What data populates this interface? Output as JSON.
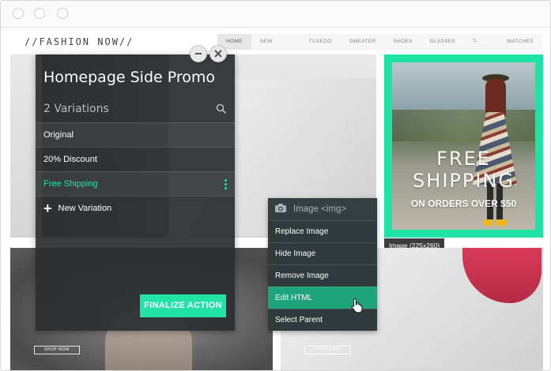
{
  "header": {
    "logo": "//FASHION NOW//",
    "nav": [
      "HOME",
      "NEW ARRIVALS",
      "TUXEDO",
      "SWEATER",
      "SHOES",
      "GLASSES",
      "T-SHIRT",
      "WATCHES"
    ]
  },
  "promo": {
    "title_line1": "FREE",
    "title_line2": "SHIPPING",
    "subtitle": "ON ORDERS OVER $50",
    "image_tag": "Image (225x260)"
  },
  "tiles": {
    "shop_now": "SHOP NOW"
  },
  "panel": {
    "title": "Homepage Side Promo",
    "count": "2 Variations",
    "variations": [
      "Original",
      "20% Discount",
      "Free Shipping"
    ],
    "new_variation": "New Variation",
    "finalize": "FINALIZE ACTION"
  },
  "context_menu": {
    "title": "Image <img>",
    "items": [
      "Replace Image",
      "Hide Image",
      "Remove Image",
      "Edit HTML",
      "Select Parent"
    ]
  },
  "colors": {
    "accent": "#22e3a6",
    "promo_border": "#1fe3a4",
    "panel_bg": "#2a2e31",
    "menu_hover": "#1fa37a"
  },
  "icons": [
    "search-icon",
    "minimize-icon",
    "close-icon",
    "camera-icon",
    "more-vertical-icon",
    "plus-icon",
    "hand-cursor-icon"
  ]
}
